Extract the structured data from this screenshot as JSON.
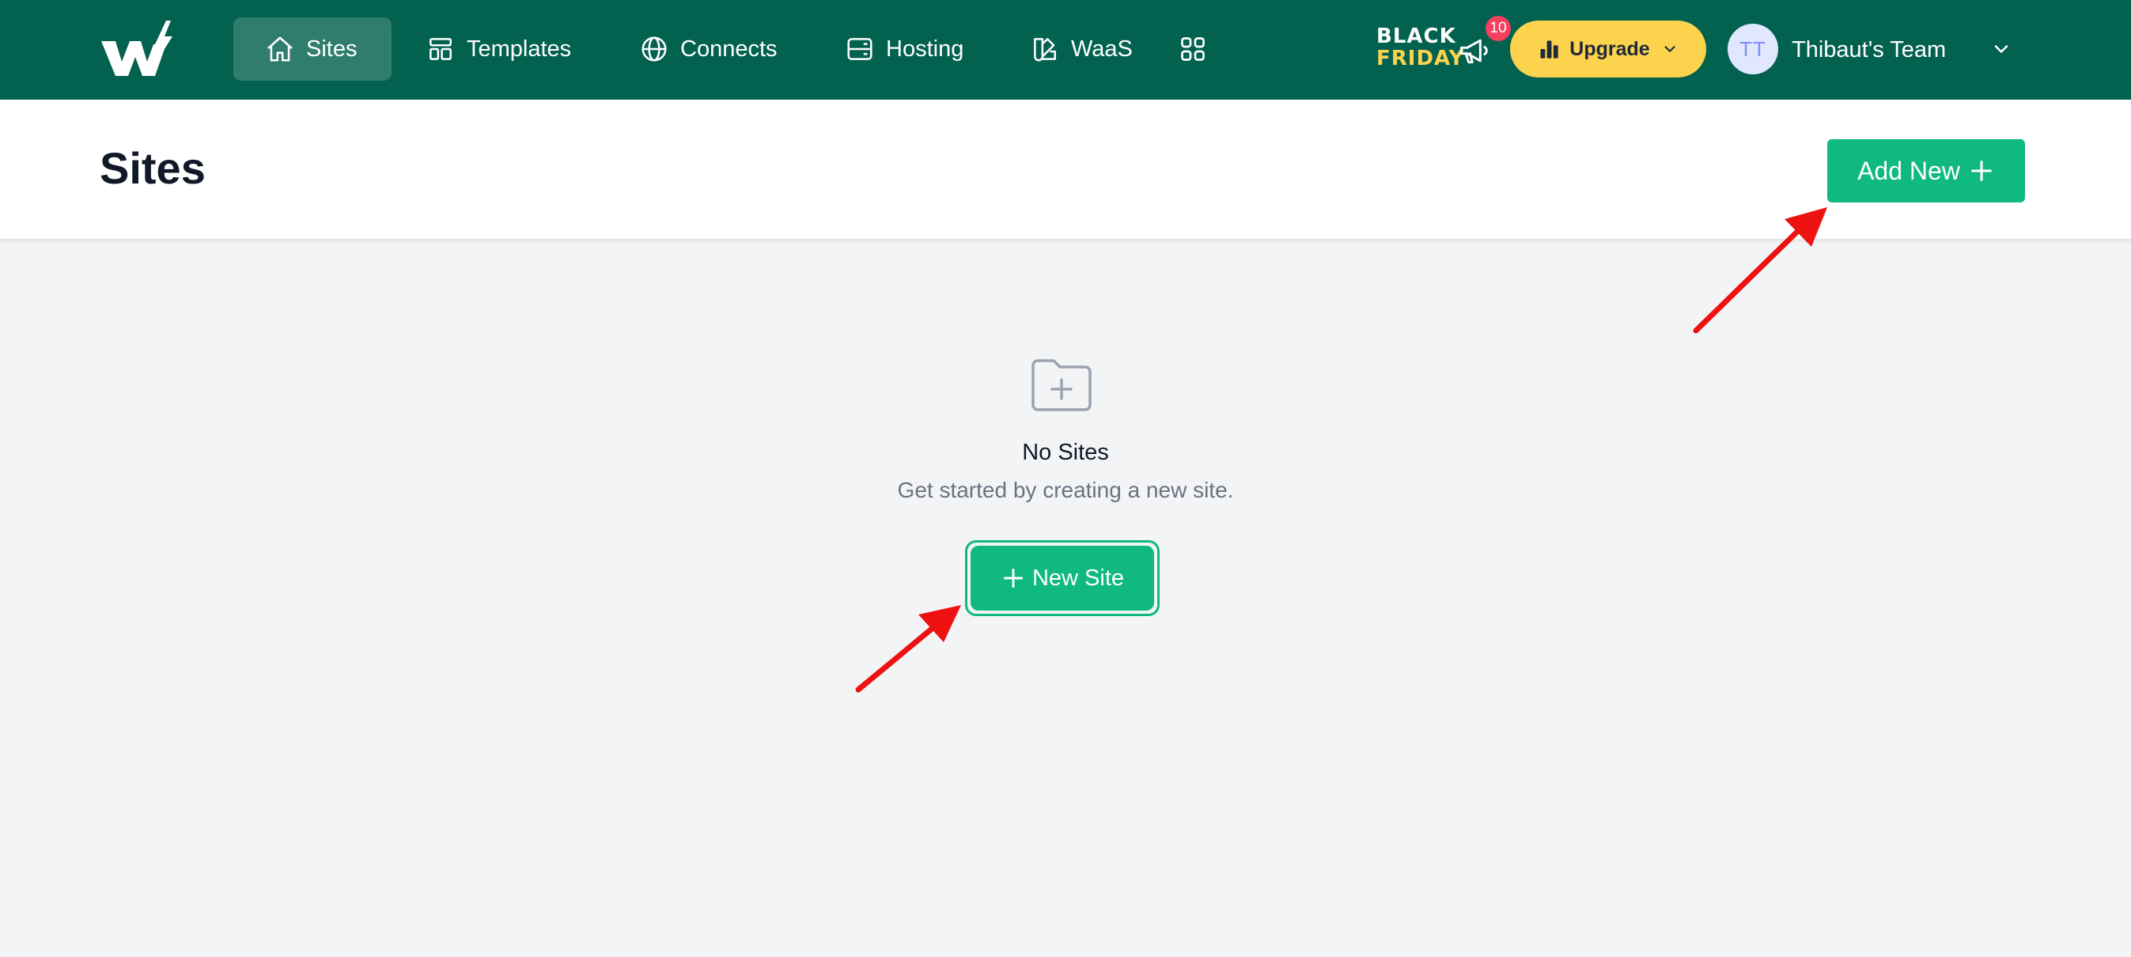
{
  "nav": {
    "items": [
      {
        "label": "Sites",
        "icon": "home-icon",
        "active": true
      },
      {
        "label": "Templates",
        "icon": "template-icon",
        "active": false
      },
      {
        "label": "Connects",
        "icon": "globe-icon",
        "active": false
      },
      {
        "label": "Hosting",
        "icon": "server-icon",
        "active": false
      },
      {
        "label": "WaaS",
        "icon": "swatch-icon",
        "active": false
      }
    ],
    "apps_icon": "grid-icon"
  },
  "promo": {
    "line1": "BLACK",
    "line2": "FRIDAY"
  },
  "notifications": {
    "count": "10",
    "icon": "megaphone-icon"
  },
  "upgrade": {
    "label": "Upgrade",
    "icon": "bar-chart-icon"
  },
  "user": {
    "initials": "TT",
    "team_name": "Thibaut's Team"
  },
  "header": {
    "title": "Sites",
    "add_new_label": "Add New"
  },
  "empty_state": {
    "icon": "folder-plus-icon",
    "title": "No Sites",
    "description": "Get started by creating a new site.",
    "button_label": "New Site"
  },
  "colors": {
    "nav_bg": "#03614f",
    "primary": "#10b981",
    "upgrade": "#fcd34d",
    "badge": "#f43f5e",
    "annotation": "#ee1111"
  }
}
